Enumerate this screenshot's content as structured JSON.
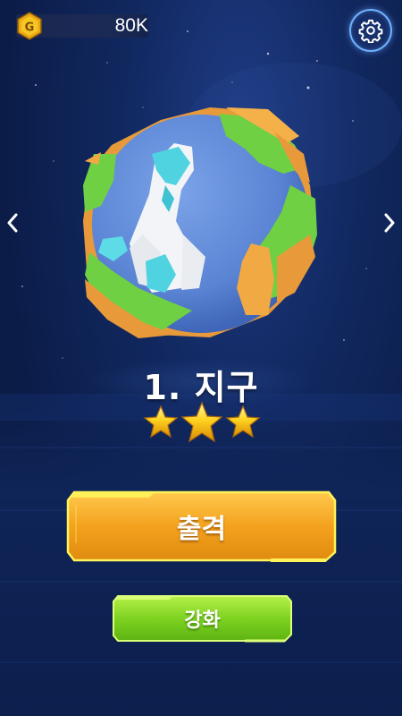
{
  "currency": {
    "icon_letter": "G",
    "value": "80K",
    "icon": "coin-g-icon",
    "color": "#f5c21b"
  },
  "settings": {
    "icon": "gear-icon"
  },
  "navigation": {
    "prev_icon": "chevron-left-icon",
    "next_icon": "chevron-right-icon"
  },
  "stage": {
    "title": "1. 지구",
    "stars_earned": 3,
    "stars_total": 3
  },
  "buttons": {
    "sortie_label": "출격",
    "upgrade_label": "강화",
    "sortie_color": "#f3a21e",
    "upgrade_color": "#7ed321"
  }
}
